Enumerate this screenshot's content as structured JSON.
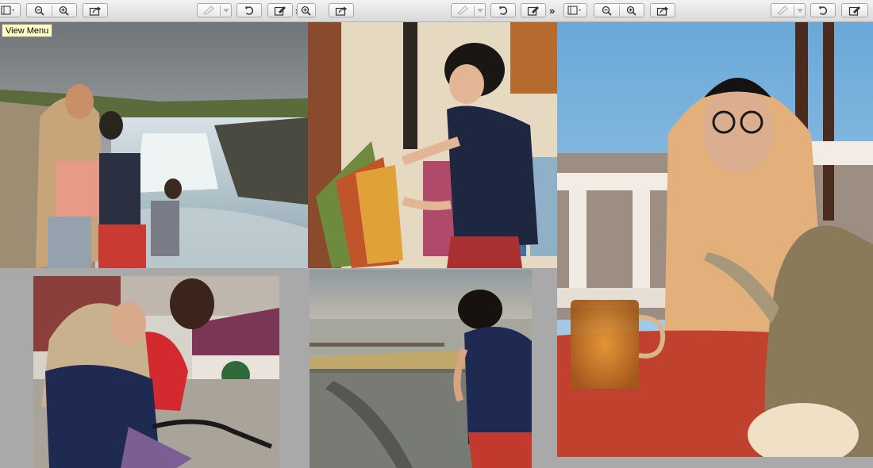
{
  "tooltip": {
    "text": "View Menu"
  },
  "toolbar": {
    "chevron": "»",
    "icons": {
      "sidebar": "sidebar-icon",
      "zoom_out": "zoom-out-icon",
      "zoom_in": "zoom-in-icon",
      "share": "share-icon",
      "highlight": "highlight-icon",
      "rotate": "rotate-icon",
      "markup": "markup-icon"
    }
  },
  "colors": {
    "toolbar": "#e0e0e0",
    "background": "#a9a9a9",
    "tooltip": "#ffffc7"
  }
}
